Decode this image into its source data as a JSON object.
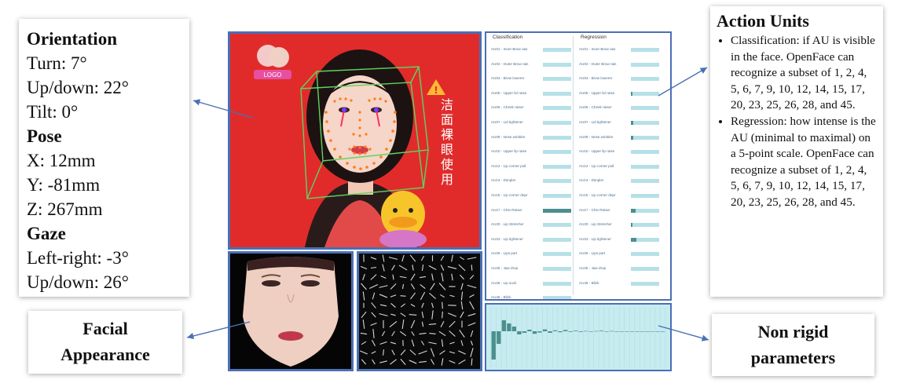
{
  "orientation": {
    "heading": "Orientation",
    "turn": "Turn: 7°",
    "updown": "Up/down: 22°",
    "tilt": "Tilt: 0°"
  },
  "pose": {
    "heading": "Pose",
    "x": "X: 12mm",
    "y": "Y: -81mm",
    "z": "Z: 267mm"
  },
  "gaze": {
    "heading": "Gaze",
    "leftright": "Left-right: -3°",
    "updown": "Up/down: 26°"
  },
  "action_units_card": {
    "title": "Action Units",
    "bullets": [
      "Classification: if AU is visible in the face. OpenFace can recognize a subset of 1, 2, 4, 5, 6, 7, 9, 10, 12, 14, 15, 17, 20, 23, 25, 26, 28, and 45.",
      "Regression: how intense is the AU (minimal to maximal) on a 5-point scale. OpenFace can recognize a subset of  1, 2, 4, 5, 6, 7, 9, 10, 12, 14, 15, 17, 20, 23, 25, 26, 28, and 45."
    ]
  },
  "facial_card": {
    "line1": "Facial",
    "line2": "Appearance"
  },
  "nonrigid_card": {
    "line1": "Non rigid",
    "line2": "parameters"
  },
  "video_overlay_text": "洁面裸眼使用",
  "au_panel": {
    "classification_heading": "Classification",
    "regression_heading": "Regression",
    "classification": [
      {
        "label": "AU01 - Inner Brow raiser",
        "value": 0
      },
      {
        "label": "AU02 - Outer Brow raiser",
        "value": 0
      },
      {
        "label": "AU04 - Brow lowerer",
        "value": 0
      },
      {
        "label": "AU05 - Upper lid raiser",
        "value": 0
      },
      {
        "label": "AU06 - Cheek raiser",
        "value": 0
      },
      {
        "label": "AU07 - Lid tightener",
        "value": 0
      },
      {
        "label": "AU09 - Nose wrinkler",
        "value": 0
      },
      {
        "label": "AU10 - Upper lip raiser",
        "value": 0
      },
      {
        "label": "AU12 - Lip corner puller",
        "value": 0
      },
      {
        "label": "AU14 - Dimpler",
        "value": 0
      },
      {
        "label": "AU15 - Lip corner depressor",
        "value": 0
      },
      {
        "label": "AU17 - Chin Raiser",
        "value": 1
      },
      {
        "label": "AU20 - Lip Stretcher",
        "value": 0
      },
      {
        "label": "AU23 - Lip tightener",
        "value": 0
      },
      {
        "label": "AU25 - Lips part",
        "value": 0
      },
      {
        "label": "AU26 - Jaw drop",
        "value": 0
      },
      {
        "label": "AU28 - Lip suck",
        "value": 0
      },
      {
        "label": "AU45 - Blink",
        "value": 0
      }
    ],
    "regression": [
      {
        "label": "AU01 - Inner Brow raiser",
        "value": 0
      },
      {
        "label": "AU02 - Outer Brow raiser",
        "value": 0
      },
      {
        "label": "AU04 - Brow lowerer",
        "value": 0
      },
      {
        "label": "AU05 - Upper lid raiser",
        "value": 0.05
      },
      {
        "label": "AU06 - Cheek raiser",
        "value": 0
      },
      {
        "label": "AU07 - Lid tightener",
        "value": 0.07
      },
      {
        "label": "AU09 - Nose wrinkler",
        "value": 0.07
      },
      {
        "label": "AU10 - Upper lip raiser",
        "value": 0
      },
      {
        "label": "AU12 - Lip corner puller",
        "value": 0
      },
      {
        "label": "AU14 - Dimpler",
        "value": 0
      },
      {
        "label": "AU15 - Lip corner depressor",
        "value": 0
      },
      {
        "label": "AU17 - Chin Raiser",
        "value": 0.18
      },
      {
        "label": "AU20 - Lip Stretcher",
        "value": 0.05
      },
      {
        "label": "AU23 - Lip tightener",
        "value": 0.2
      },
      {
        "label": "AU25 - Lips part",
        "value": 0
      },
      {
        "label": "AU26 - Jaw drop",
        "value": 0
      },
      {
        "label": "AU45 - Blink",
        "value": 0
      }
    ]
  },
  "nonrigid_params": [
    -0.9,
    -0.4,
    0.35,
    0.25,
    0.15,
    -0.1,
    -0.05,
    0.05,
    -0.08,
    -0.04,
    0.06,
    -0.05,
    0.03,
    -0.03,
    0.04,
    -0.02,
    0.02,
    -0.02,
    0.01,
    -0.01,
    0.01,
    0.02,
    -0.01,
    0.01,
    0,
    0,
    0,
    0,
    0,
    0,
    0,
    0,
    0,
    0
  ],
  "colors": {
    "panel_border": "#4a6fb5",
    "video_bg": "#e12b2b",
    "landmark": "#ff7a1a",
    "bbox": "#5fd35f",
    "au_bar": "#b6e0e7",
    "au_fill": "#4c8f8f",
    "arrow": "#4a6fb5"
  }
}
